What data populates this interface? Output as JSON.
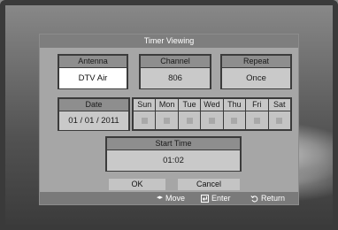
{
  "dialog": {
    "title": "Timer Viewing"
  },
  "antenna": {
    "label": "Antenna",
    "value": "DTV Air"
  },
  "channel": {
    "label": "Channel",
    "value": "806"
  },
  "repeat": {
    "label": "Repeat",
    "value": "Once"
  },
  "date": {
    "label": "Date",
    "value": "01 / 01 / 2011"
  },
  "days": [
    {
      "label": "Sun"
    },
    {
      "label": "Mon"
    },
    {
      "label": "Tue"
    },
    {
      "label": "Wed"
    },
    {
      "label": "Thu"
    },
    {
      "label": "Fri"
    },
    {
      "label": "Sat"
    }
  ],
  "start_time": {
    "label": "Start Time",
    "value": "01:02"
  },
  "buttons": {
    "ok": "OK",
    "cancel": "Cancel"
  },
  "footer": {
    "move": "Move",
    "enter": "Enter",
    "return": "Return"
  }
}
